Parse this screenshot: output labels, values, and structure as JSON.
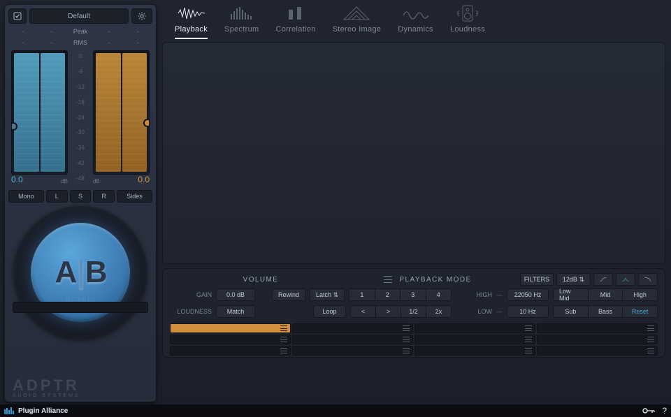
{
  "header": {
    "preset_label": "Default",
    "tabs": [
      {
        "id": "playback",
        "label": "Playback",
        "active": true
      },
      {
        "id": "spectrum",
        "label": "Spectrum",
        "active": false
      },
      {
        "id": "correlation",
        "label": "Correlation",
        "active": false
      },
      {
        "id": "stereo",
        "label": "Stereo Image",
        "active": false
      },
      {
        "id": "dynamics",
        "label": "Dynamics",
        "active": false
      },
      {
        "id": "loudness",
        "label": "Loudness",
        "active": false
      }
    ]
  },
  "meters": {
    "peak_label": "Peak",
    "rms_label": "RMS",
    "a": {
      "value": "0.0",
      "unit": "dB",
      "peak_l": "-",
      "peak_r": "-",
      "rms_l": "-",
      "rms_r": "-"
    },
    "b": {
      "value": "0.0",
      "unit": "dB",
      "peak_l": "-",
      "peak_r": "-",
      "rms_l": "-",
      "rms_r": "-"
    },
    "scale": [
      "0",
      "-6",
      "-12",
      "-18",
      "-24",
      "-30",
      "-36",
      "-42",
      "-48"
    ]
  },
  "monitor": {
    "buttons": [
      "Mono",
      "L",
      "S",
      "R",
      "Sides"
    ]
  },
  "ab": {
    "a": "A",
    "b": "B",
    "metric": "METRIC"
  },
  "brand": {
    "name": "ADPTR",
    "sub": "AUDIO SYSTEMS"
  },
  "volume": {
    "title": "VOLUME",
    "gain_label": "GAIN",
    "gain_value": "0.0 dB",
    "loudness_label": "LOUDNESS",
    "match_label": "Match"
  },
  "playback": {
    "title": "PLAYBACK MODE",
    "rewind": "Rewind",
    "latch": "Latch",
    "loop": "Loop",
    "numbers": [
      "1",
      "2",
      "3",
      "4"
    ],
    "nav": [
      "<",
      ">",
      "1/2",
      "2x"
    ]
  },
  "filters": {
    "label": "FILTERS",
    "slope": "12dB",
    "high_label": "HIGH",
    "high_value": "22050 Hz",
    "low_label": "LOW",
    "low_value": "10 Hz",
    "bands1": [
      "Low Mid",
      "Mid",
      "High"
    ],
    "bands2": [
      "Sub",
      "Bass",
      "Reset"
    ]
  },
  "footer": {
    "brand": "Plugin Alliance"
  }
}
